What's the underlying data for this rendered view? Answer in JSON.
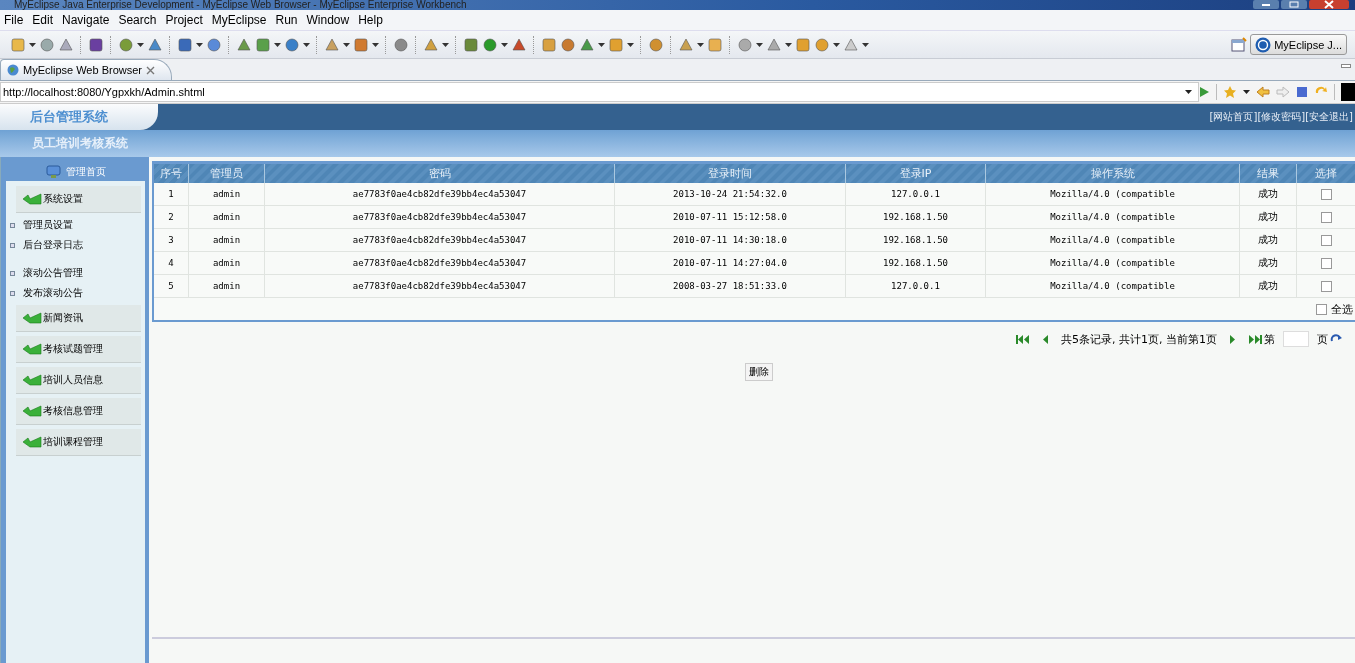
{
  "window": {
    "title": "MyEclipse Java Enterprise Development - MyEclipse Web Browser - MyEclipse Enterprise Workbench"
  },
  "menu": [
    "File",
    "Edit",
    "Navigate",
    "Search",
    "Project",
    "MyEclipse",
    "Run",
    "Window",
    "Help"
  ],
  "perspective": {
    "label": "MyEclipse J..."
  },
  "editor_tab": {
    "label": "MyEclipse Web Browser"
  },
  "address": {
    "value": "http://localhost:8080/Ygpxkh/Admin.shtml"
  },
  "site": {
    "logo": "后台管理系统",
    "subtitle": "员工培训考核系统",
    "links": [
      "[网站首页]",
      "[修改密码]",
      "[安全退出]"
    ]
  },
  "sidebar": {
    "home": "管理首页",
    "items": [
      {
        "kind": "section",
        "label": "系统设置"
      },
      {
        "kind": "link",
        "label": "管理员设置"
      },
      {
        "kind": "link",
        "label": "后台登录日志"
      },
      {
        "kind": "link",
        "label": "滚动公告管理"
      },
      {
        "kind": "link",
        "label": "发布滚动公告"
      },
      {
        "kind": "section",
        "label": "新闻资讯"
      },
      {
        "kind": "section",
        "label": "考核试题管理"
      },
      {
        "kind": "section",
        "label": "培训人员信息"
      },
      {
        "kind": "section",
        "label": "考核信息管理"
      },
      {
        "kind": "section",
        "label": "培训课程管理"
      }
    ]
  },
  "table": {
    "columns": [
      "序号",
      "管理员",
      "密码",
      "登录时间",
      "登录IP",
      "操作系统",
      "结果",
      "选择"
    ],
    "rows": [
      {
        "cells": [
          "1",
          "admin",
          "ae7783f0ae4cb82dfe39bb4ec4a53047",
          "2013-10-24 21:54:32.0",
          "127.0.0.1",
          "Mozilla/4.0 (compatible",
          "成功"
        ],
        "checked": false
      },
      {
        "cells": [
          "2",
          "admin",
          "ae7783f0ae4cb82dfe39bb4ec4a53047",
          "2010-07-11 15:12:58.0",
          "192.168.1.50",
          "Mozilla/4.0 (compatible",
          "成功"
        ],
        "checked": false
      },
      {
        "cells": [
          "3",
          "admin",
          "ae7783f0ae4cb82dfe39bb4ec4a53047",
          "2010-07-11 14:30:18.0",
          "192.168.1.50",
          "Mozilla/4.0 (compatible",
          "成功"
        ],
        "checked": false
      },
      {
        "cells": [
          "4",
          "admin",
          "ae7783f0ae4cb82dfe39bb4ec4a53047",
          "2010-07-11 14:27:04.0",
          "192.168.1.50",
          "Mozilla/4.0 (compatible",
          "成功"
        ],
        "checked": false
      },
      {
        "cells": [
          "5",
          "admin",
          "ae7783f0ae4cb82dfe39bb4ec4a53047",
          "2008-03-27 18:51:33.0",
          "127.0.0.1",
          "Mozilla/4.0 (compatible",
          "成功"
        ],
        "checked": false
      }
    ],
    "select_all": {
      "label": "全选",
      "checked": false
    }
  },
  "pager": {
    "summary": "共5条记录, 共计1页, 当前第1页",
    "page_prefix": "第",
    "page_suffix": "页"
  },
  "delete_button": "删除"
}
